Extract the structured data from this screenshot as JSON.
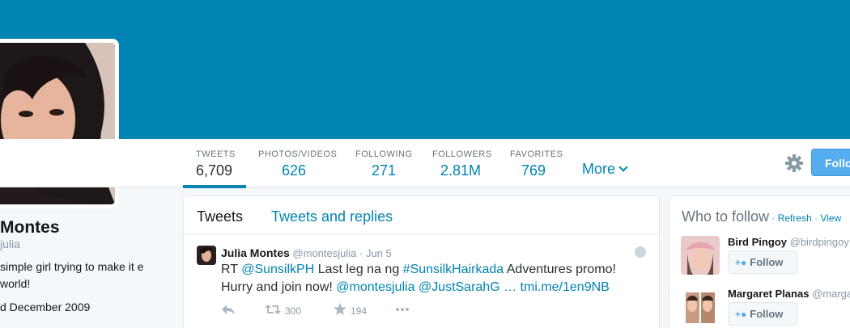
{
  "profile": {
    "name": "Montes",
    "handle": "julia",
    "bio": "simple girl trying to make it e world!",
    "joined": "d December 2009"
  },
  "nav": {
    "items": [
      {
        "label": "TWEETS",
        "value": "6,709"
      },
      {
        "label": "PHOTOS/VIDEOS",
        "value": "626"
      },
      {
        "label": "FOLLOWING",
        "value": "271"
      },
      {
        "label": "FOLLOWERS",
        "value": "2.81M"
      },
      {
        "label": "FAVORITES",
        "value": "769"
      }
    ],
    "more": "More"
  },
  "header": {
    "follow_label": "Follo",
    "banner_color": "#0084b4",
    "accent_color": "#55acee"
  },
  "stream": {
    "tabs": [
      {
        "label": "Tweets"
      },
      {
        "label": "Tweets and replies"
      }
    ],
    "tweet": {
      "name": "Julia Montes",
      "handle": "@montesjulia",
      "date": "· Jun 5",
      "text_parts": [
        {
          "t": "RT ",
          "link": false
        },
        {
          "t": "@SunsilkPH",
          "link": true
        },
        {
          "t": " Last leg na ng ",
          "link": false
        },
        {
          "t": "#SunsilkHairkada",
          "link": true
        },
        {
          "t": " Adventures promo! Hurry and join now! ",
          "link": false
        },
        {
          "t": "@montesjulia",
          "link": true
        },
        {
          "t": " ",
          "link": false
        },
        {
          "t": "@JustSarahG",
          "link": true
        },
        {
          "t": " … tmi.me/1en9NB",
          "link": true
        }
      ],
      "retweets": "300",
      "favorites": "194",
      "icons": [
        "reply-icon",
        "retweet-icon",
        "favorite-icon",
        "more-icon",
        "globe-icon"
      ]
    }
  },
  "who_to_follow": {
    "title": "Who to follow",
    "refresh": "Refresh",
    "view": "View",
    "separator": " · ",
    "users": [
      {
        "name": "Bird Pingoy",
        "handle": "@birdpingoy"
      },
      {
        "name": "Margaret Planas",
        "handle": "@marga"
      }
    ],
    "follow_label": "Follow"
  }
}
